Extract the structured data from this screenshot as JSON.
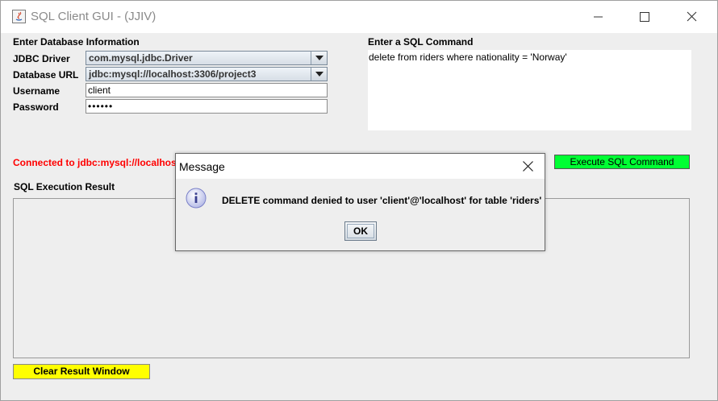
{
  "window": {
    "title": "SQL Client GUI - (JJIV)"
  },
  "db_info": {
    "heading": "Enter Database Information",
    "jdbc_driver_label": "JDBC Driver",
    "jdbc_driver_value": "com.mysql.jdbc.Driver",
    "database_url_label": "Database URL",
    "database_url_value": "jdbc:mysql://localhost:3306/project3",
    "username_label": "Username",
    "username_value": "client",
    "password_label": "Password",
    "password_value": "••••••"
  },
  "sql": {
    "heading": "Enter a SQL Command",
    "command": "delete from riders where nationality = 'Norway'",
    "execute_label": "Execute SQL Command"
  },
  "status": {
    "text": "Connected to jdbc:mysql://localhost",
    "color": "#ff0000"
  },
  "result": {
    "heading": "SQL Execution Result",
    "clear_label": "Clear Result Window"
  },
  "dialog": {
    "title": "Message",
    "message": "DELETE command denied to user 'client'@'localhost' for table 'riders'",
    "ok_label": "OK"
  },
  "colors": {
    "execute_button": "#00ff33",
    "clear_button": "#ffff00"
  },
  "icons": [
    "java-app-icon",
    "minimize-icon",
    "maximize-icon",
    "close-icon",
    "info-icon"
  ]
}
